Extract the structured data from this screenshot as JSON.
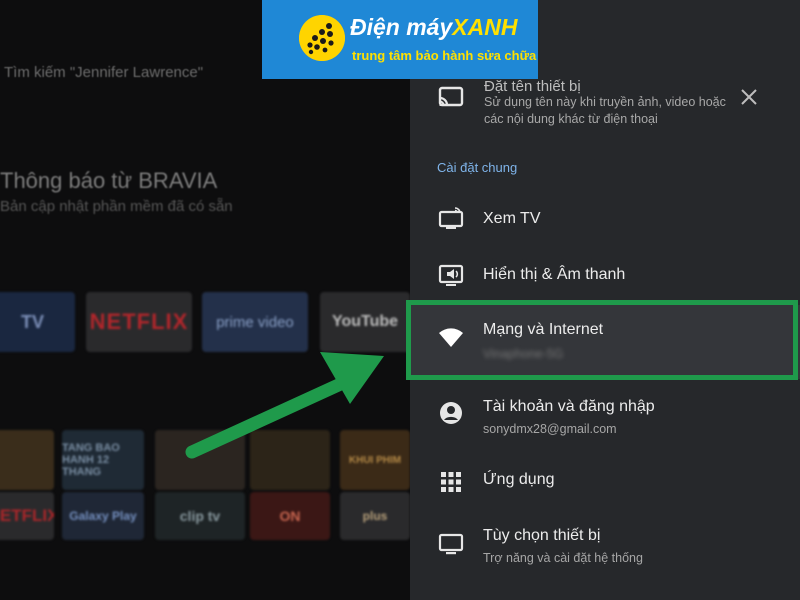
{
  "home": {
    "search_hint": "Tìm kiếm \"Jennifer Lawrence\"",
    "notice_title": "Thông báo từ BRAVIA",
    "notice_sub": "Bản cập nhật phần mềm đã có sẵn",
    "apps_row1": [
      "TV",
      "NETFLIX",
      "prime video",
      "YouTube"
    ],
    "apps_row2": [
      "",
      "TANG BAO HANH 12 THANG",
      "",
      "",
      "KHUI PHIM"
    ],
    "apps_row3": [
      "NETFLIX",
      "Galaxy Play",
      "clip tv",
      "ON",
      "plus"
    ]
  },
  "banner": {
    "brand_main": "Điện máy",
    "brand_accent": "XANH",
    "slogan": "trung tâm bảo hành sửa chữa"
  },
  "settings": {
    "top_item": {
      "title": "Đặt tên thiết bị",
      "desc_line1": "Sử dụng tên này khi truyền ảnh, video hoặc",
      "desc_line2": "các nội dung khác từ điện thoại",
      "icon": "cast-icon"
    },
    "section_label": "Cài đặt chung",
    "items": [
      {
        "label": "Xem TV",
        "icon": "tv-antenna-icon"
      },
      {
        "label": "Hiển thị & Âm thanh",
        "icon": "display-sound-icon"
      },
      {
        "label": "Mạng và Internet",
        "sub": "Vinaphone-5G",
        "icon": "wifi-icon"
      },
      {
        "label": "Tài khoản và đăng nhập",
        "sub": "sonydmx28@gmail.com",
        "icon": "account-icon"
      },
      {
        "label": "Ứng dụng",
        "icon": "apps-grid-icon"
      },
      {
        "label": "Tùy chọn thiết bị",
        "sub": "Trợ năng và cài đặt hệ thống",
        "icon": "monitor-icon"
      }
    ]
  },
  "colors": {
    "panel_bg": "#26282b",
    "accent_blue": "#7fb4ea",
    "highlight_green": "#1f9a4b",
    "banner_blue": "#1f88d6",
    "banner_yellow": "#ffe000"
  }
}
